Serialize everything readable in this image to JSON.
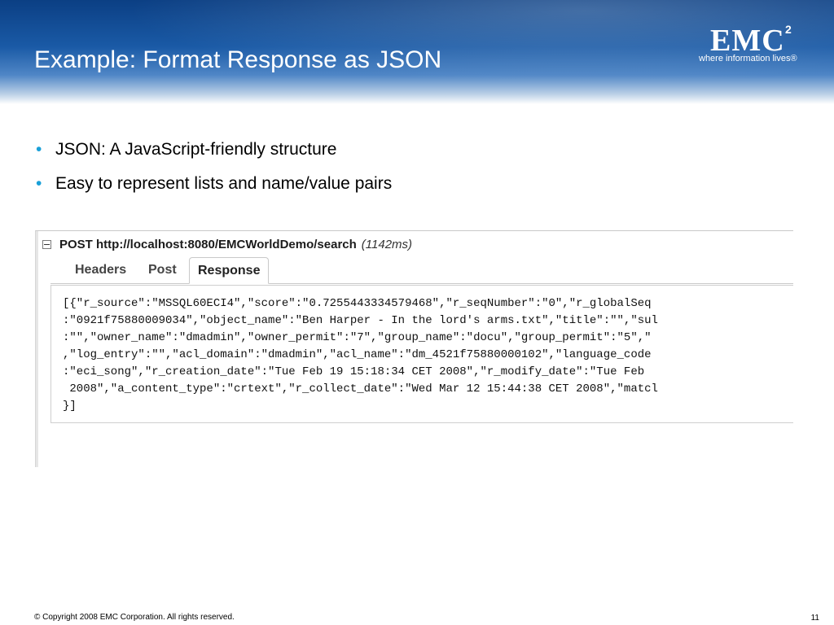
{
  "slide": {
    "title": "Example: Format Response as JSON",
    "number": "11",
    "copyright": "© Copyright 2008 EMC Corporation. All rights reserved."
  },
  "logo": {
    "word": "EMC",
    "superscript": "2",
    "tagline": "where information lives®"
  },
  "bullets": [
    "JSON: A JavaScript-friendly structure",
    "Easy to represent lists and name/value pairs"
  ],
  "panel": {
    "request": {
      "method_url": "POST http://localhost:8080/EMCWorldDemo/search",
      "time": "(1142ms)"
    },
    "tabs": [
      "Headers",
      "Post",
      "Response"
    ],
    "active_tab": "Response",
    "response_lines": [
      "[{\"r_source\":\"MSSQL60ECI4\",\"score\":\"0.7255443334579468\",\"r_seqNumber\":\"0\",\"r_globalSeq",
      ":\"0921f75880009034\",\"object_name\":\"Ben Harper - In the lord's arms.txt\",\"title\":\"\",\"sul",
      ":\"\",\"owner_name\":\"dmadmin\",\"owner_permit\":\"7\",\"group_name\":\"docu\",\"group_permit\":\"5\",\"",
      ",\"log_entry\":\"\",\"acl_domain\":\"dmadmin\",\"acl_name\":\"dm_4521f75880000102\",\"language_code",
      ":\"eci_song\",\"r_creation_date\":\"Tue Feb 19 15:18:34 CET 2008\",\"r_modify_date\":\"Tue Feb",
      " 2008\",\"a_content_type\":\"crtext\",\"r_collect_date\":\"Wed Mar 12 15:44:38 CET 2008\",\"matcl",
      "}]"
    ]
  },
  "colors": {
    "banner_dark": "#0b3f84",
    "bullet": "#1aa0d8"
  }
}
